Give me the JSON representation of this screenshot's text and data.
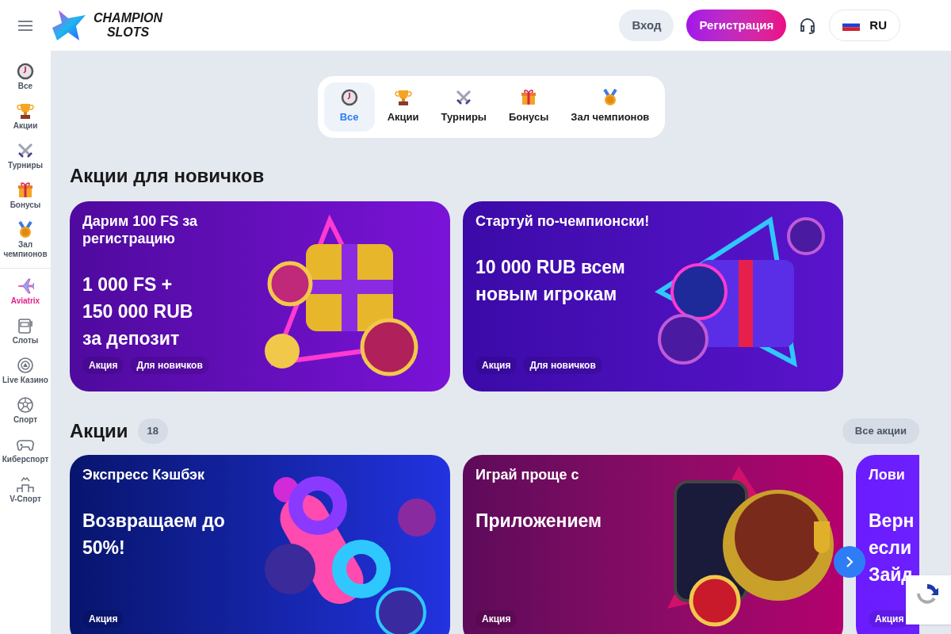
{
  "header": {
    "logo_line_1": "CHAMPION",
    "logo_line_2": "SLOTS",
    "login": "Вход",
    "register": "Регистрация",
    "language": "RU"
  },
  "sidebar": {
    "promo_items": [
      {
        "label": "Все"
      },
      {
        "label": "Акции"
      },
      {
        "label": "Турниры"
      },
      {
        "label": "Бонусы"
      },
      {
        "label": "Зал чемпионов"
      }
    ],
    "game_items": [
      {
        "label": "Aviatrix",
        "highlighted": true
      },
      {
        "label": "Слоты",
        "highlighted": false
      },
      {
        "label": "Live Казино",
        "highlighted": false
      },
      {
        "label": "Спорт",
        "highlighted": false
      },
      {
        "label": "Киберспорт",
        "highlighted": false
      },
      {
        "label": "V-Спорт",
        "highlighted": false
      }
    ]
  },
  "tabs": [
    {
      "label": "Все",
      "selected": true
    },
    {
      "label": "Акции",
      "selected": false
    },
    {
      "label": "Турниры",
      "selected": false
    },
    {
      "label": "Бонусы",
      "selected": false
    },
    {
      "label": "Зал чемпионов",
      "selected": false
    }
  ],
  "newcomer_section": {
    "title": "Акции для новичков",
    "cards": [
      {
        "title": "Дарим 100 FS за регистрацию",
        "headline": [
          "1 000 FS +",
          "150 000 RUB",
          "за депозит"
        ],
        "tags": [
          "Акция",
          "Для новичков"
        ]
      },
      {
        "title": "Стартуй по-чемпионски!",
        "headline": [
          "10 000 RUB всем",
          "новым игрокам"
        ],
        "tags": [
          "Акция",
          "Для новичков"
        ]
      }
    ]
  },
  "promo_section": {
    "title": "Акции",
    "count": "18",
    "all_button": "Все акции",
    "cards": [
      {
        "title": "Экспресс Кэшбэк",
        "headline": [
          "Возвращаем до",
          "50%!"
        ],
        "tags": [
          "Акция"
        ]
      },
      {
        "title": "Играй проще с",
        "headline": [
          "Приложением"
        ],
        "tags": [
          "Акция"
        ]
      },
      {
        "title": "Лови",
        "headline": [
          "Верн",
          "если",
          "Зайд"
        ],
        "tags": [
          "Акция"
        ]
      }
    ]
  }
}
